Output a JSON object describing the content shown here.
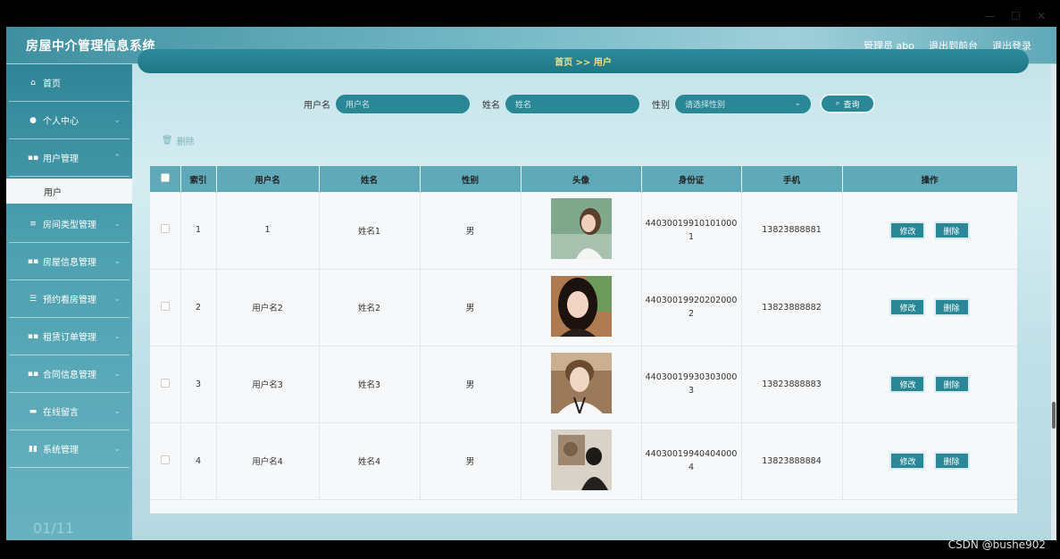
{
  "header": {
    "title": "房屋中介管理信息系统",
    "user": "管理员 abo",
    "to_front": "退出到前台",
    "logout": "退出登录"
  },
  "sidebar": {
    "items": [
      {
        "label": "首页",
        "icon": "home-icon",
        "glyph": "⌂"
      },
      {
        "label": "个人中心",
        "icon": "user-icon",
        "glyph": "●"
      },
      {
        "label": "用户管理",
        "icon": "grid-icon",
        "glyph": "▪▪"
      },
      {
        "label": "房间类型管理",
        "icon": "list-icon",
        "glyph": "≡"
      },
      {
        "label": "房屋信息管理",
        "icon": "grid-icon",
        "glyph": "▪▪"
      },
      {
        "label": "预约看房管理",
        "icon": "sliders-icon",
        "glyph": "☰"
      },
      {
        "label": "租赁订单管理",
        "icon": "grid-icon",
        "glyph": "▪▪"
      },
      {
        "label": "合同信息管理",
        "icon": "grid-icon",
        "glyph": "▪▪"
      },
      {
        "label": "在线留言",
        "icon": "monitor-icon",
        "glyph": "▬"
      },
      {
        "label": "系统管理",
        "icon": "chart-icon",
        "glyph": "▮▮"
      }
    ],
    "sub_item": "用户",
    "footer": "01/11"
  },
  "breadcrumb": "首页 >> 用户",
  "search": {
    "username_label": "用户名",
    "username_placeholder": "用户名",
    "name_label": "姓名",
    "name_placeholder": "姓名",
    "gender_label": "性别",
    "gender_placeholder": "请选择性别",
    "query_button": "查询"
  },
  "delete_button": "删除",
  "table": {
    "headers": [
      "索引",
      "用户名",
      "姓名",
      "性别",
      "头像",
      "身份证",
      "手机",
      "操作"
    ],
    "edit_label": "修改",
    "delete_label": "删除",
    "rows": [
      {
        "index": "1",
        "username": "1",
        "name": "姓名1",
        "gender": "男",
        "id_line1": "44030019910101000",
        "id_line2": "1",
        "phone": "13823888881"
      },
      {
        "index": "2",
        "username": "用户名2",
        "name": "姓名2",
        "gender": "男",
        "id_line1": "44030019920202000",
        "id_line2": "2",
        "phone": "13823888882"
      },
      {
        "index": "3",
        "username": "用户名3",
        "name": "姓名3",
        "gender": "男",
        "id_line1": "44030019930303000",
        "id_line2": "3",
        "phone": "13823888883"
      },
      {
        "index": "4",
        "username": "用户名4",
        "name": "姓名4",
        "gender": "男",
        "id_line1": "44030019940404000",
        "id_line2": "4",
        "phone": "13823888884"
      }
    ]
  },
  "watermark": "CSDN @bushe902"
}
